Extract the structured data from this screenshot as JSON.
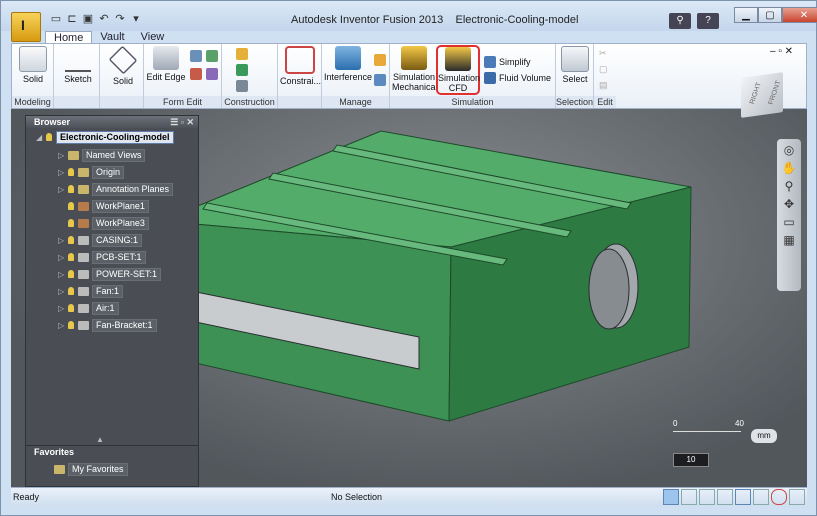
{
  "window": {
    "title": "Autodesk Inventor Fusion 2013",
    "document": "Electronic-Cooling-model"
  },
  "app_button": {
    "label": "I"
  },
  "quick_access": [
    "new-icon",
    "open-icon",
    "save-icon",
    "undo-icon",
    "redo-icon",
    "dropdown-icon"
  ],
  "tabs": [
    {
      "label": "Home",
      "active": true
    },
    {
      "label": "Vault"
    },
    {
      "label": "View"
    }
  ],
  "ribbon": {
    "groups": [
      {
        "label": "Modeling"
      },
      {
        "label": ""
      },
      {
        "label": ""
      },
      {
        "label": "Form Edit"
      },
      {
        "label": "Construction"
      },
      {
        "label": ""
      },
      {
        "label": "Manage"
      },
      {
        "label": "Simulation"
      },
      {
        "label": "Selection"
      },
      {
        "label": "Edit"
      }
    ],
    "buttons": {
      "solid1": "Solid",
      "sketch": "Sketch",
      "solid2": "Solid",
      "edit_edge": "Edit Edge",
      "constrain": "Constrai...",
      "interference": "Interference",
      "sim_mech_1": "Simulation",
      "sim_mech_2": "Mechanical",
      "sim_cfd_1": "Simulation",
      "sim_cfd_2": "CFD",
      "simplify": "Simplify",
      "fluid_volume": "Fluid Volume",
      "select": "Select"
    }
  },
  "browser": {
    "title": "Browser",
    "root": "Electronic-Cooling-model",
    "items": [
      "Named Views",
      "Origin",
      "Annotation Planes",
      "WorkPlane1",
      "WorkPlane3",
      "CASING:1",
      "PCB-SET:1",
      "POWER-SET:1",
      "Fan:1",
      "Air:1",
      "Fan-Bracket:1"
    ]
  },
  "favorites": {
    "title": "Favorites",
    "item": "My Favorites"
  },
  "ruler": {
    "min": "0",
    "max": "40",
    "unit": "mm",
    "value": "10"
  },
  "viewcube": {
    "face_right": "RIGHT",
    "face_front": "FRONT"
  },
  "status": {
    "left": "Ready",
    "center": "No Selection"
  },
  "colors": {
    "model_green": "#3e9a5b",
    "highlight": "#e03030"
  }
}
